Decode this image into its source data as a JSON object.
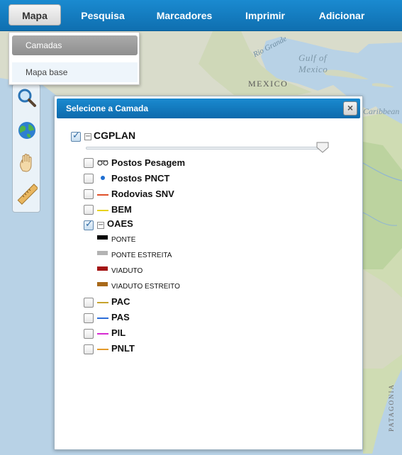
{
  "nav": {
    "items": [
      "Mapa",
      "Pesquisa",
      "Marcadores",
      "Imprimir",
      "Adicionar"
    ],
    "active_index": 0
  },
  "dropdown": {
    "items": [
      "Camadas",
      "Mapa base"
    ],
    "selected_index": 0
  },
  "tools": [
    "search-icon",
    "globe-icon",
    "hand-icon",
    "ruler-icon"
  ],
  "map": {
    "labels": {
      "gulf": "Gulf of\nMexico",
      "country": "MEXICO",
      "river": "Rio Grande",
      "sea": "Caribbean",
      "region": "PATAGONIA"
    }
  },
  "dialog": {
    "title": "Selecione a Camada",
    "close_label": "×",
    "root": {
      "label": "CGPLAN",
      "checked": true,
      "collapse_symbol": "−"
    },
    "opacity": 1.0,
    "layers": [
      {
        "label": "Postos Pesagem",
        "checked": false,
        "symbol": "scale-icon"
      },
      {
        "label": "Postos PNCT",
        "checked": false,
        "symbol": "dot",
        "color": "#1f6fd1"
      },
      {
        "label": "Rodovias SNV",
        "checked": false,
        "symbol": "line",
        "color": "#e0502a"
      },
      {
        "label": "BEM",
        "checked": false,
        "symbol": "line",
        "color": "#e8d21d"
      },
      {
        "label": "OAES",
        "checked": true,
        "symbol": "group",
        "collapse_symbol": "−"
      },
      {
        "label": "PAC",
        "checked": false,
        "symbol": "line",
        "color": "#c6a32c"
      },
      {
        "label": "PAS",
        "checked": false,
        "symbol": "line",
        "color": "#2d6ed8"
      },
      {
        "label": "PIL",
        "checked": false,
        "symbol": "line",
        "color": "#d62ad1"
      },
      {
        "label": "PNLT",
        "checked": false,
        "symbol": "line",
        "color": "#e39a2b"
      }
    ],
    "oaes_legend": [
      {
        "label": "PONTE",
        "color": "#000000"
      },
      {
        "label": "PONTE ESTREITA",
        "color": "#b3b3b3"
      },
      {
        "label": "VIADUTO",
        "color": "#a31414"
      },
      {
        "label": "VIADUTO ESTREITO",
        "color": "#a8691a"
      }
    ]
  }
}
